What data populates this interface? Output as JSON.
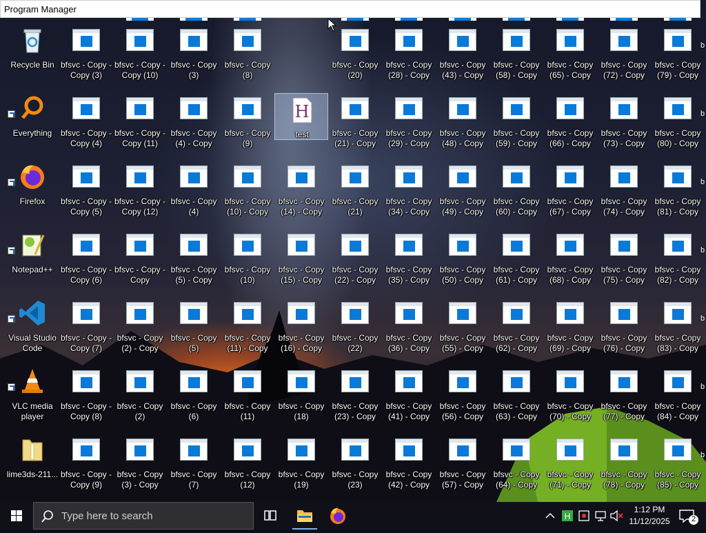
{
  "window": {
    "title": "Program Manager"
  },
  "desktop": {
    "system_icons": [
      {
        "id": "recycle-bin",
        "label": "Recycle Bin"
      },
      {
        "id": "everything",
        "label": "Everything"
      },
      {
        "id": "firefox",
        "label": "Firefox"
      },
      {
        "id": "notepadpp",
        "label": "Notepad++"
      },
      {
        "id": "vscode",
        "label": "Visual Studio Code"
      },
      {
        "id": "vlc",
        "label": "VLC media player"
      },
      {
        "id": "lime3ds",
        "label": "lime3ds-211..."
      }
    ],
    "selected_file": {
      "label": "test"
    },
    "files": [
      "bfsvc - Copy - Copy (3)",
      "bfsvc - Copy - Copy (10)",
      "bfsvc - Copy (3)",
      "bfsvc - Copy (8)",
      "bfsvc - Copy (20)",
      "bfsvc - Copy (28) - Copy",
      "bfsvc - Copy (43) - Copy",
      "bfsvc - Copy (58) - Copy",
      "bfsvc - Copy (65) - Copy",
      "bfsvc - Copy (72) - Copy",
      "bfsvc - Copy (79) - Copy",
      "bfsvc - Copy - Copy (4)",
      "bfsvc - Copy - Copy (11)",
      "bfsvc - Copy (4) - Copy",
      "bfsvc - Copy (9)",
      "bfsvc - Copy (21) - Copy",
      "bfsvc - Copy (29) - Copy",
      "bfsvc - Copy (48) - Copy",
      "bfsvc - Copy (59) - Copy",
      "bfsvc - Copy (66) - Copy",
      "bfsvc - Copy (73) - Copy",
      "bfsvc - Copy (80) - Copy",
      "bfsvc - Copy - Copy (5)",
      "bfsvc - Copy - Copy (12)",
      "bfsvc - Copy (4)",
      "bfsvc - Copy (10) - Copy",
      "bfsvc - Copy (14) - Copy",
      "bfsvc - Copy (21)",
      "bfsvc - Copy (34) - Copy",
      "bfsvc - Copy (49) - Copy",
      "bfsvc - Copy (60) - Copy",
      "bfsvc - Copy (67) - Copy",
      "bfsvc - Copy (74) - Copy",
      "bfsvc - Copy (81) - Copy",
      "bfsvc - Copy - Copy (6)",
      "bfsvc - Copy - Copy",
      "bfsvc - Copy (5) - Copy",
      "bfsvc - Copy (10)",
      "bfsvc - Copy (15) - Copy",
      "bfsvc - Copy (22) - Copy",
      "bfsvc - Copy (35) - Copy",
      "bfsvc - Copy (50) - Copy",
      "bfsvc - Copy (61) - Copy",
      "bfsvc - Copy (68) - Copy",
      "bfsvc - Copy (75) - Copy",
      "bfsvc - Copy (82) - Copy",
      "bfsvc - Copy - Copy (7)",
      "bfsvc - Copy (2) - Copy",
      "bfsvc - Copy (5)",
      "bfsvc - Copy (11) - Copy",
      "bfsvc - Copy (16) - Copy",
      "bfsvc - Copy (22)",
      "bfsvc - Copy (36) - Copy",
      "bfsvc - Copy (55) - Copy",
      "bfsvc - Copy (62) - Copy",
      "bfsvc - Copy (69) - Copy",
      "bfsvc - Copy (76) - Copy",
      "bfsvc - Copy (83) - Copy",
      "bfsvc - Copy - Copy (8)",
      "bfsvc - Copy (2)",
      "bfsvc - Copy (6)",
      "bfsvc - Copy (11)",
      "bfsvc - Copy (18)",
      "bfsvc - Copy (23) - Copy",
      "bfsvc - Copy (41) - Copy",
      "bfsvc - Copy (56) - Copy",
      "bfsvc - Copy (63) - Copy",
      "bfsvc - Copy (70) - Copy",
      "bfsvc - Copy (77) - Copy",
      "bfsvc - Copy (84) - Copy",
      "bfsvc - Copy - Copy (9)",
      "bfsvc - Copy (3) - Copy",
      "bfsvc - Copy (7)",
      "bfsvc - Copy (12)",
      "bfsvc - Copy (19)",
      "bfsvc - Copy (23)",
      "bfsvc - Copy (42) - Copy",
      "bfsvc - Copy (57) - Copy",
      "bfsvc - Copy (64) - Copy",
      "bfsvc - Copy (71) - Copy",
      "bfsvc - Copy (78) - Copy",
      "bfsvc - Copy (85) - Copy"
    ],
    "edge_fragments": [
      "b",
      "b",
      "b",
      "b",
      "b",
      "b",
      "b"
    ]
  },
  "taskbar": {
    "search_placeholder": "Type here to search",
    "clock_time": "1:12 PM",
    "clock_date": "11/12/2025",
    "notification_count": "2",
    "icons": {
      "start": "windows-logo-icon",
      "search": "magnifier-icon",
      "task_view": "task-view-icon",
      "explorer": "folder-icon",
      "firefox": "firefox-icon",
      "tray_overflow": "chevron-up-icon",
      "tray_app": "green-h-app-icon",
      "security": "security-icon",
      "network": "network-icon",
      "volume": "volume-muted-icon",
      "notifications": "notification-icon"
    }
  },
  "colors": {
    "exe_blue": "#0a7ad9",
    "taskbar_bg": "#101118",
    "selection": "#aabedc"
  }
}
